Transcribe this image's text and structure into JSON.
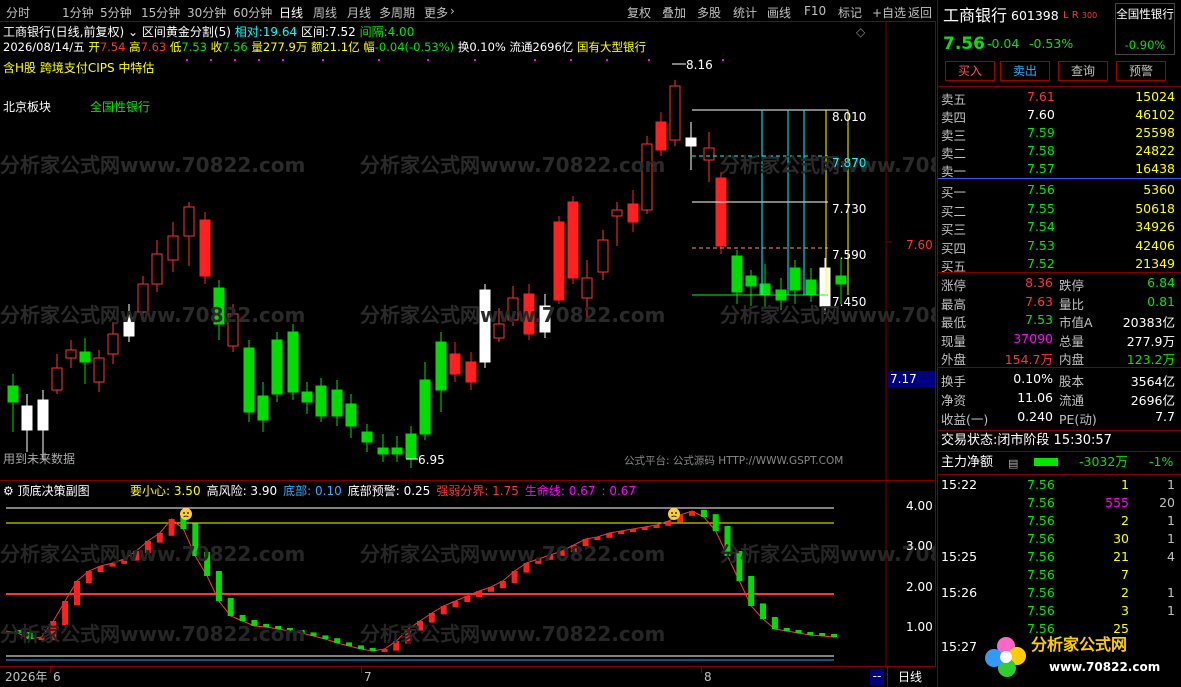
{
  "toolbar": {
    "left": [
      "分时",
      "1分钟",
      "5分钟",
      "15分钟",
      "30分钟",
      "60分钟",
      "日线",
      "周线",
      "月线",
      "多周期",
      "更多"
    ],
    "right": [
      "复权",
      "叠加",
      "多股",
      "统计",
      "画线",
      "F10",
      "标记",
      "+自选",
      "返回"
    ],
    "active": "日线"
  },
  "main": {
    "title": "工商银行(日线,前复权)",
    "indicator": "区间黄金分割(5)",
    "rel_label": "相对:",
    "rel_val": "19.64",
    "range_label": "区间:",
    "range_val": "7.52",
    "gap_label": "间隔:",
    "gap_val": "4.00",
    "date": "2026/08/14/五",
    "open_l": "开",
    "open": "7.54",
    "high_l": "高",
    "high": "7.63",
    "low_l": "低",
    "low": "7.53",
    "close_l": "收",
    "close": "7.56",
    "vol_l": "量",
    "vol": "277.9万",
    "amt_l": "额",
    "amt": "21.1亿",
    "chg_l": "幅",
    "chg": "-0.04(-0.53%)",
    "turn_l": "换",
    "turn": "0.10%",
    "float_l": "流通",
    "float": "2696亿",
    "category": "国有大型银行",
    "tags": "含H股 跨境支付CIPS 中特估",
    "board_label": "北京板块",
    "board_name": "全国性银行",
    "future_note": "用到未来数据",
    "watermark": "分析家公式网www.70822.com",
    "platform": "公式平台: 公式源码 HTTP://WWW.GSPT.COM",
    "price_marks": {
      "high": "8.16",
      "low": "6.95"
    },
    "fib_levels": [
      "8.010",
      "7.870",
      "7.730",
      "7.590",
      "7.450"
    ],
    "axis_right_label": "7.60",
    "axis_cursor": "7.17"
  },
  "sub": {
    "title": "顶底决策副图",
    "items": [
      {
        "label": "要小心: ",
        "value": "3.50",
        "color": "#ffff00"
      },
      {
        "label": "高风险: ",
        "value": "3.90",
        "color": "#ffffff"
      },
      {
        "label": "底部: ",
        "value": "0.10",
        "color": "#33aaff"
      },
      {
        "label": "底部预警: ",
        "value": "0.25",
        "color": "#ffffff"
      },
      {
        "label": "强弱分界: ",
        "value": "1.75",
        "color": "#ff3333"
      },
      {
        "label": "生命线: ",
        "value": "0.67",
        "color": "#ff00ff"
      },
      {
        "label": ": ",
        "value": "0.67",
        "color": "#ff00ff"
      }
    ],
    "yaxis": [
      "4.00",
      "3.00",
      "2.00",
      "1.00"
    ]
  },
  "xaxis": {
    "year": "2026年",
    "m6": "6",
    "m7": "7",
    "m8": "8",
    "period": "日线",
    "scroll": "--"
  },
  "stock": {
    "name": "工商银行",
    "code": "601398",
    "flag": "L R",
    "flag_sub": "300",
    "price": "7.56",
    "chg": "-0.04",
    "pct": "-0.53%",
    "sector_name": "全国性银行",
    "sector_pct": "-0.90%",
    "buttons": [
      "买入",
      "卖出",
      "查询",
      "预警"
    ]
  },
  "orderbook": {
    "sells": [
      {
        "label": "卖五",
        "price": "7.61",
        "vol": "15024",
        "pcolor": "#ff3333"
      },
      {
        "label": "卖四",
        "price": "7.60",
        "vol": "46102",
        "pcolor": "#ffffff"
      },
      {
        "label": "卖三",
        "price": "7.59",
        "vol": "25598",
        "pcolor": "#00e600"
      },
      {
        "label": "卖二",
        "price": "7.58",
        "vol": "24822",
        "pcolor": "#00e600"
      },
      {
        "label": "卖一",
        "price": "7.57",
        "vol": "16438",
        "pcolor": "#00e600"
      }
    ],
    "buys": [
      {
        "label": "买一",
        "price": "7.56",
        "vol": "5360",
        "pcolor": "#00e600"
      },
      {
        "label": "买二",
        "price": "7.55",
        "vol": "50618",
        "pcolor": "#00e600"
      },
      {
        "label": "买三",
        "price": "7.54",
        "vol": "34926",
        "pcolor": "#00e600"
      },
      {
        "label": "买四",
        "price": "7.53",
        "vol": "42406",
        "pcolor": "#00e600"
      },
      {
        "label": "买五",
        "price": "7.52",
        "vol": "21349",
        "pcolor": "#00e600"
      }
    ]
  },
  "stats": [
    {
      "l1": "涨停",
      "v1": "8.36",
      "c1": "#ff3333",
      "l2": "跌停",
      "v2": "6.84",
      "c2": "#00e600"
    },
    {
      "l1": "最高",
      "v1": "7.63",
      "c1": "#ff3333",
      "l2": "量比",
      "v2": "0.81",
      "c2": "#00e600"
    },
    {
      "l1": "最低",
      "v1": "7.53",
      "c1": "#00e600",
      "l2": "市值A",
      "v2": "20383亿",
      "c2": "#ffffff"
    },
    {
      "l1": "现量",
      "v1": "37090",
      "c1": "#ff00ff",
      "l2": "总量",
      "v2": "277.9万",
      "c2": "#ffffff"
    },
    {
      "l1": "外盘",
      "v1": "154.7万",
      "c1": "#ff3333",
      "l2": "内盘",
      "v2": "123.2万",
      "c2": "#00e600"
    },
    {
      "l1": "换手",
      "v1": "0.10%",
      "c1": "#ffffff",
      "l2": "股本",
      "v2": "3564亿",
      "c2": "#ffffff"
    },
    {
      "l1": "净资",
      "v1": "11.06",
      "c1": "#ffffff",
      "l2": "流通",
      "v2": "2696亿",
      "c2": "#ffffff"
    },
    {
      "l1": "收益(一)",
      "v1": "0.240",
      "c1": "#ffffff",
      "l2": "PE(动)",
      "v2": "7.7",
      "c2": "#ffffff"
    }
  ],
  "trade_status": {
    "label": "交易状态:",
    "value": "闭市阶段",
    "time": "15:30:57"
  },
  "flow": {
    "label": "主力净额",
    "value": "-3032万",
    "pct": "-1%"
  },
  "ticks": [
    {
      "time": "15:22",
      "price": "7.56",
      "vol": "1",
      "vcolor": "#ffff00",
      "n": "1"
    },
    {
      "time": "",
      "price": "7.56",
      "vol": "555",
      "vcolor": "#ff00ff",
      "n": "20"
    },
    {
      "time": "",
      "price": "7.56",
      "vol": "2",
      "vcolor": "#ffff00",
      "n": "1"
    },
    {
      "time": "",
      "price": "7.56",
      "vol": "30",
      "vcolor": "#ffff00",
      "n": "1"
    },
    {
      "time": "15:25",
      "price": "7.56",
      "vol": "21",
      "vcolor": "#ffff00",
      "n": "4"
    },
    {
      "time": "",
      "price": "7.56",
      "vol": "7",
      "vcolor": "#ffff00",
      "n": ""
    },
    {
      "time": "15:26",
      "price": "7.56",
      "vol": "2",
      "vcolor": "#ffff00",
      "n": "1"
    },
    {
      "time": "",
      "price": "7.56",
      "vol": "3",
      "vcolor": "#ffff00",
      "n": "1"
    },
    {
      "time": "",
      "price": "7.56",
      "vol": "25",
      "vcolor": "#ffff00",
      "n": ""
    },
    {
      "time": "15:27",
      "price": "",
      "vol": "",
      "vcolor": "#ffff00",
      "n": ""
    }
  ],
  "logo": {
    "title": "分析家公式网",
    "url": "www.70822.com"
  },
  "colors": {
    "up": "#ff3333",
    "down": "#00e600",
    "border": "#800000"
  }
}
